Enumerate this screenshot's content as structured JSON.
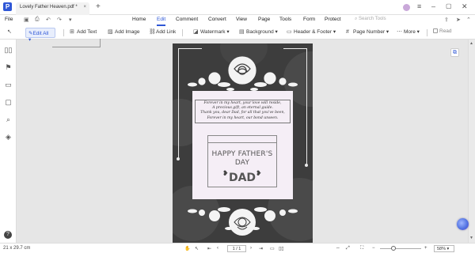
{
  "titlebar": {
    "tab_title": "Lovely Father Heaven.pdf *",
    "tab_close": "×",
    "new_tab": "+"
  },
  "menu": {
    "file": "File",
    "items": [
      "Home",
      "Edit",
      "Comment",
      "Convert",
      "View",
      "Page",
      "Tools",
      "Form",
      "Protect"
    ],
    "active": "Edit",
    "search_placeholder": "Search Tools"
  },
  "toolbar": {
    "edit_all": "Edit All",
    "add_text": "Add Text",
    "add_image": "Add Image",
    "add_link": "Add Link",
    "watermark": "Watermark",
    "background": "Background",
    "header_footer": "Header & Footer",
    "page_number": "Page Number",
    "more": "More",
    "read": "Read"
  },
  "document": {
    "poem_lines": [
      "Forever in my heart, your love will reside,",
      "A precious gift, an eternal guide.",
      "Thank you, dear Dad, for all that you've been,",
      "Forever in my heart, our bond unseen."
    ],
    "happy_line1": "HAPPY FATHER'S",
    "happy_line2": "DAY",
    "dad": "DAD"
  },
  "status": {
    "page_size": "21 x 29.7 cm",
    "page_indicator": "1 / 1",
    "zoom": "58%",
    "zoom_fraction": 0.58
  },
  "colors": {
    "accent": "#2f57d6",
    "page_bg": "#3d3d3d",
    "panel_bg": "#f5eef6"
  }
}
